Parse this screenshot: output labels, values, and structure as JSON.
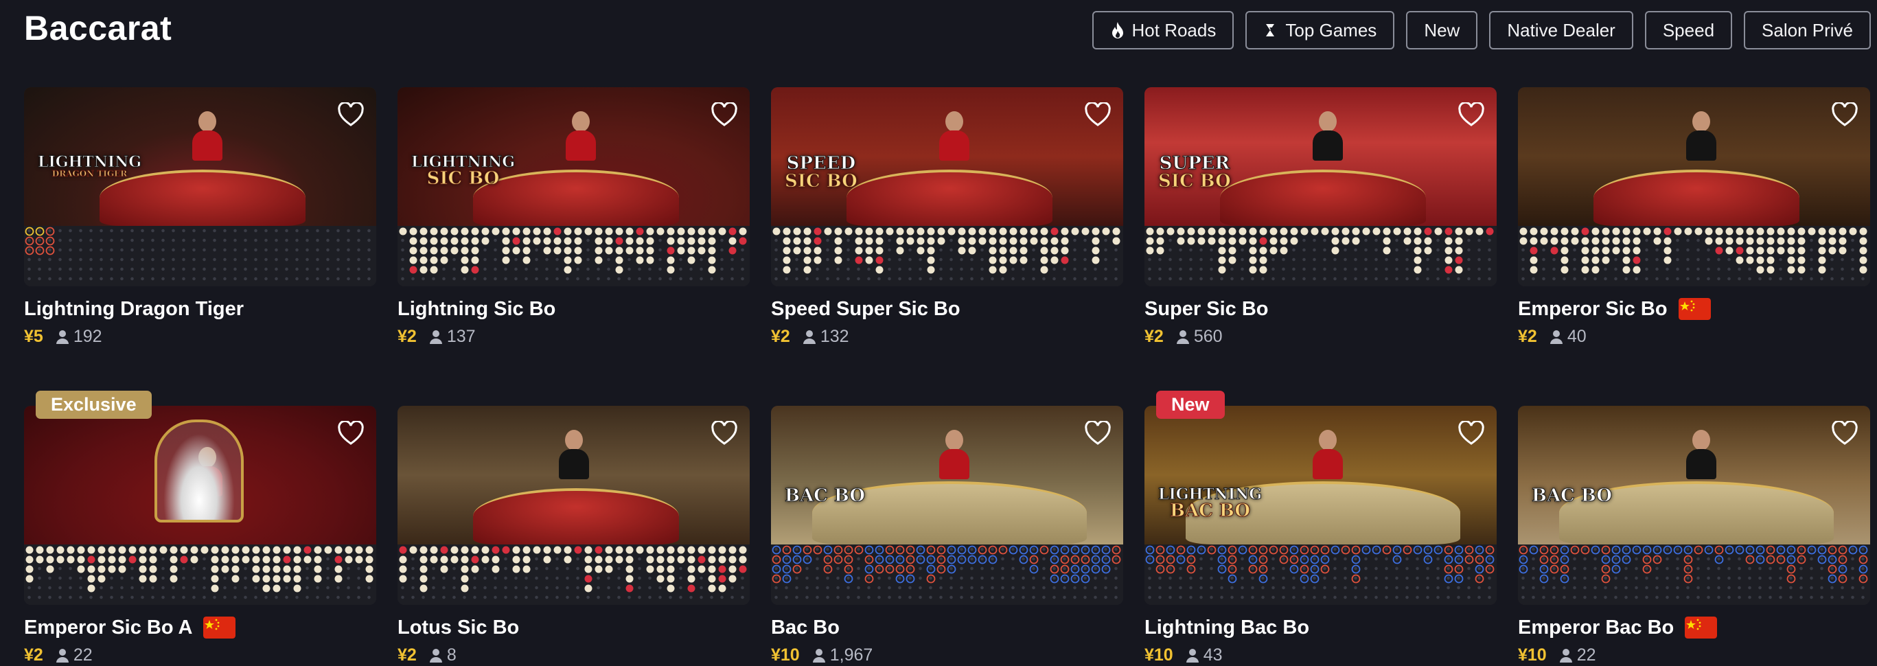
{
  "page": {
    "title": "Baccarat"
  },
  "filters": [
    {
      "label": "Hot Roads",
      "icon": "flame-icon"
    },
    {
      "label": "Top Games",
      "icon": "top-games-icon"
    },
    {
      "label": "New"
    },
    {
      "label": "Native Dealer"
    },
    {
      "label": "Speed"
    },
    {
      "label": "Salon Privé"
    }
  ],
  "colors": {
    "stake": "#f1c232",
    "badge_exclusive": "#b89a5a",
    "badge_new": "#d7303f",
    "flag_red": "#de2910",
    "flag_star": "#ffde00"
  },
  "games": [
    {
      "name": "Lightning Dragon Tiger",
      "stake": "¥5",
      "players": "192",
      "logo": "LIGHTNING",
      "logo_sub": "DRAGON TIGER",
      "flag": false,
      "badge": ""
    },
    {
      "name": "Lightning Sic Bo",
      "stake": "¥2",
      "players": "137",
      "logo": "LIGHTNING",
      "logo_sub": "SIC BO",
      "flag": false,
      "badge": ""
    },
    {
      "name": "Speed Super Sic Bo",
      "stake": "¥2",
      "players": "132",
      "logo": "SPEED",
      "logo_sub": "SIC BO",
      "flag": false,
      "badge": ""
    },
    {
      "name": "Super Sic Bo",
      "stake": "¥2",
      "players": "560",
      "logo": "SUPER",
      "logo_sub": "SIC BO",
      "flag": false,
      "badge": ""
    },
    {
      "name": "Emperor Sic Bo",
      "stake": "¥2",
      "players": "40",
      "logo": "",
      "logo_sub": "",
      "flag": true,
      "badge": ""
    },
    {
      "name": "Emperor Sic Bo A",
      "stake": "¥2",
      "players": "22",
      "logo": "",
      "logo_sub": "",
      "flag": true,
      "badge": "Exclusive"
    },
    {
      "name": "Lotus Sic Bo",
      "stake": "¥2",
      "players": "8",
      "logo": "",
      "logo_sub": "",
      "flag": false,
      "badge": ""
    },
    {
      "name": "Bac Bo",
      "stake": "¥10",
      "players": "1,967",
      "logo": "BAC BO",
      "logo_sub": "",
      "flag": false,
      "badge": ""
    },
    {
      "name": "Lightning Bac Bo",
      "stake": "¥10",
      "players": "43",
      "logo": "LIGHTNING",
      "logo_sub": "BAC BO",
      "flag": false,
      "badge": "New"
    },
    {
      "name": "Emperor Bac Bo",
      "stake": "¥10",
      "players": "22",
      "logo": "BAC BO",
      "logo_sub": "",
      "flag": true,
      "badge": ""
    }
  ]
}
